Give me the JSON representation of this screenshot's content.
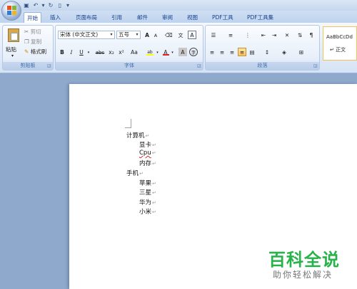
{
  "tabs": [
    "开始",
    "插入",
    "页面布局",
    "引用",
    "邮件",
    "审阅",
    "视图",
    "PDF工具",
    "PDF工具集"
  ],
  "active_tab": "开始",
  "clipboard": {
    "paste": "粘贴",
    "cut": "剪切",
    "copy": "复制",
    "format_painter": "格式刷",
    "label": "剪贴板"
  },
  "font": {
    "name": "宋体 (中文正文)",
    "size": "五号",
    "label": "字体",
    "grow": "A",
    "shrink": "A",
    "bold": "B",
    "italic": "I",
    "underline": "U",
    "strike": "abc",
    "sub": "x₂",
    "sup": "x²",
    "case": "Aa",
    "highlight": "ab",
    "color": "A",
    "shade": "A",
    "wen": "文",
    "border_a": "A",
    "circle": "字"
  },
  "paragraph": {
    "label": "段落",
    "pilcrow": "¶"
  },
  "styles": {
    "preview": "AaBbCcDd",
    "name": "正文"
  },
  "document": {
    "lines": [
      {
        "text": "计算机",
        "level": 0
      },
      {
        "text": "显卡",
        "level": 1
      },
      {
        "text": "Cpu",
        "level": 1,
        "spell_error": true
      },
      {
        "text": "内存",
        "level": 1
      },
      {
        "text": "手机",
        "level": 0
      },
      {
        "text": "苹果",
        "level": 1
      },
      {
        "text": "三星",
        "level": 1
      },
      {
        "text": "华为",
        "level": 1
      },
      {
        "text": "小米",
        "level": 1
      }
    ],
    "para_mark": "↵"
  },
  "watermark": {
    "title": "百科全说",
    "subtitle": "助你轻松解决"
  },
  "colors": {
    "highlight": "#ffff00",
    "font_color": "#e02020",
    "watermark_green": "#27b24a"
  }
}
